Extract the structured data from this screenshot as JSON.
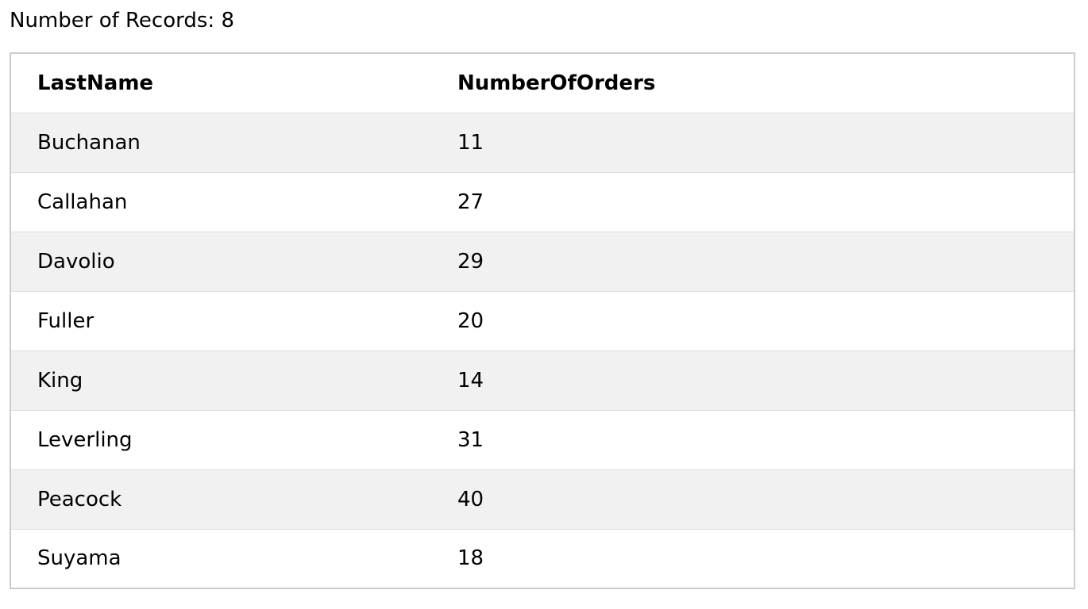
{
  "summary": {
    "label": "Number of Records:",
    "count": "8"
  },
  "table": {
    "headers": [
      "LastName",
      "NumberOfOrders"
    ],
    "rows": [
      {
        "last_name": "Buchanan",
        "number_of_orders": "11"
      },
      {
        "last_name": "Callahan",
        "number_of_orders": "27"
      },
      {
        "last_name": "Davolio",
        "number_of_orders": "29"
      },
      {
        "last_name": "Fuller",
        "number_of_orders": "20"
      },
      {
        "last_name": "King",
        "number_of_orders": "14"
      },
      {
        "last_name": "Leverling",
        "number_of_orders": "31"
      },
      {
        "last_name": "Peacock",
        "number_of_orders": "40"
      },
      {
        "last_name": "Suyama",
        "number_of_orders": "18"
      }
    ]
  },
  "colors": {
    "row_stripe": "#f1f1f1",
    "row_plain": "#ffffff",
    "border": "#cccccc",
    "row_divider": "#dddddd"
  }
}
